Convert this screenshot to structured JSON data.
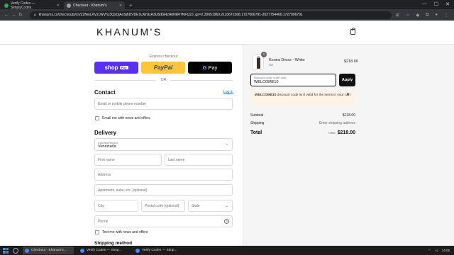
{
  "browser": {
    "tabs": [
      {
        "label": "Verify Codes — SimplyCodes",
        "active": false
      },
      {
        "label": "Checkout - Khanum's",
        "active": true
      }
    ],
    "url": "khanums.co/checkouts/cn/Z2NwLXVzLWVhc3QxOjAxSjhDVDE1UWUzA3U6dGRzA0NkRTNFQ2J_gs=2.20651960.2110672368.1727006791-2027754460.1727006791"
  },
  "store": {
    "logo": "KHANUM'S"
  },
  "express": {
    "label": "Express checkout",
    "shop_pay": "shop",
    "shop_pay_badge": "Pay",
    "paypal": "PayPal",
    "gpay_g": "G",
    "gpay": "Pay",
    "or": "OR"
  },
  "contact": {
    "title": "Contact",
    "login": "Log in",
    "email_placeholder": "Email or mobile phone number",
    "newsletter": "Email me with news and offers"
  },
  "delivery": {
    "title": "Delivery",
    "country_label": "Country/Region",
    "country_value": "Venezuela",
    "first_name": "First name",
    "last_name": "Last name",
    "address": "Address",
    "apartment": "Apartment, suite, etc. (optional)",
    "city": "City",
    "postal": "Postal code (optional)",
    "state": "State",
    "phone": "Phone",
    "text_offers": "Text me with news and offers"
  },
  "shipping_method": {
    "title": "Shipping method"
  },
  "cart": {
    "item": {
      "name": "Konea Dress - White",
      "size": "XS",
      "price": "$218.00",
      "quantity": "1"
    },
    "discount_label": "Discount code or gift card",
    "discount_value": "WELCOME10",
    "apply": "Apply",
    "error_code": "WELCOME10",
    "error_text": " discount code isn't valid for the items in your cart",
    "subtotal_label": "Subtotal",
    "subtotal_value": "$218.00",
    "shipping_label": "Shipping",
    "shipping_value": "Enter shipping address",
    "total_label": "Total",
    "total_currency": "USD",
    "total_value": "$218.00"
  },
  "taskbar": {
    "items": [
      {
        "label": "Checkout - Khanum's...",
        "active": true
      },
      {
        "label": "Verify Codes — Simp...",
        "active": false
      },
      {
        "label": "Verify Codes — Simp...",
        "active": false
      }
    ],
    "time": "14:06"
  },
  "colors": {
    "shop_pay": "#5a31f4",
    "paypal": "#ffc439",
    "error_bg": "#fff3e6",
    "link": "#1773b0"
  }
}
